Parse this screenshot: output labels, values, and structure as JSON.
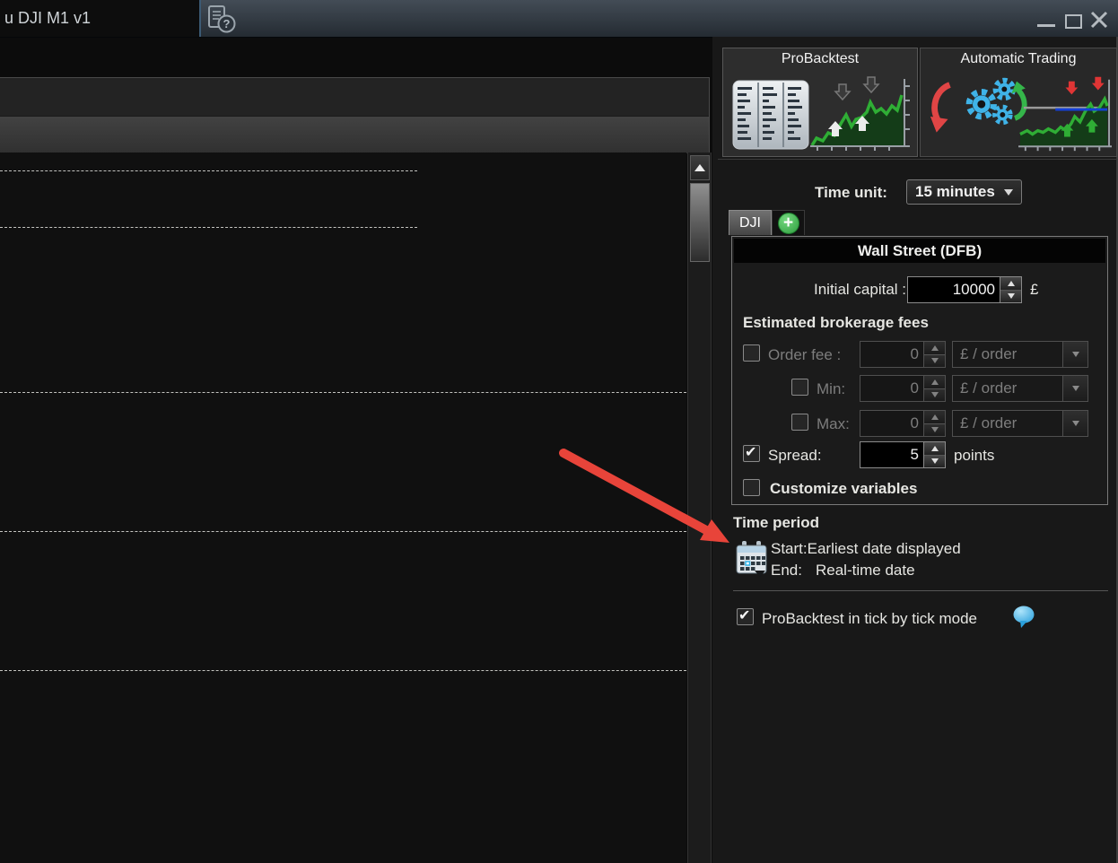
{
  "titlebar": {
    "title": "u DJI M1 v1"
  },
  "glyphs": {
    "check": "✔",
    "help": "?",
    "plus": "+"
  },
  "colors": {
    "accent_green": "#3cb54a",
    "arrow_red": "#e8443a",
    "bubble_blue": "#45b4ea",
    "chart_green": "#2fae35",
    "panel_bg": "#181818",
    "titlebar_gradient_top": "#434c56"
  },
  "tabs": {
    "probacktest": "ProBacktest",
    "automatic_trading": "Automatic Trading"
  },
  "settings": {
    "time_unit_label": "Time unit:",
    "time_unit_value": "15 minutes",
    "instrument_tab": "DJI",
    "instrument_header": "Wall Street (DFB)",
    "initial_capital_label": "Initial capital :",
    "initial_capital_value": "10000",
    "currency": "£",
    "fees_heading": "Estimated brokerage fees",
    "order_fee": {
      "label": "Order fee :",
      "value": "0",
      "unit": "£ / order",
      "checked": false
    },
    "min_fee": {
      "label": "Min:",
      "value": "0",
      "unit": "£ / order",
      "checked": false
    },
    "max_fee": {
      "label": "Max:",
      "value": "0",
      "unit": "£ / order",
      "checked": false
    },
    "spread": {
      "label": "Spread:",
      "value": "5",
      "unit": "points",
      "checked": true
    },
    "customize_label": "Customize variables"
  },
  "time_period": {
    "heading": "Time period",
    "start_label": "Start:",
    "start_value": "Earliest date displayed",
    "end_label": "End:",
    "end_value": "Real-time date"
  },
  "tick_mode_label": "ProBacktest in tick by tick mode"
}
